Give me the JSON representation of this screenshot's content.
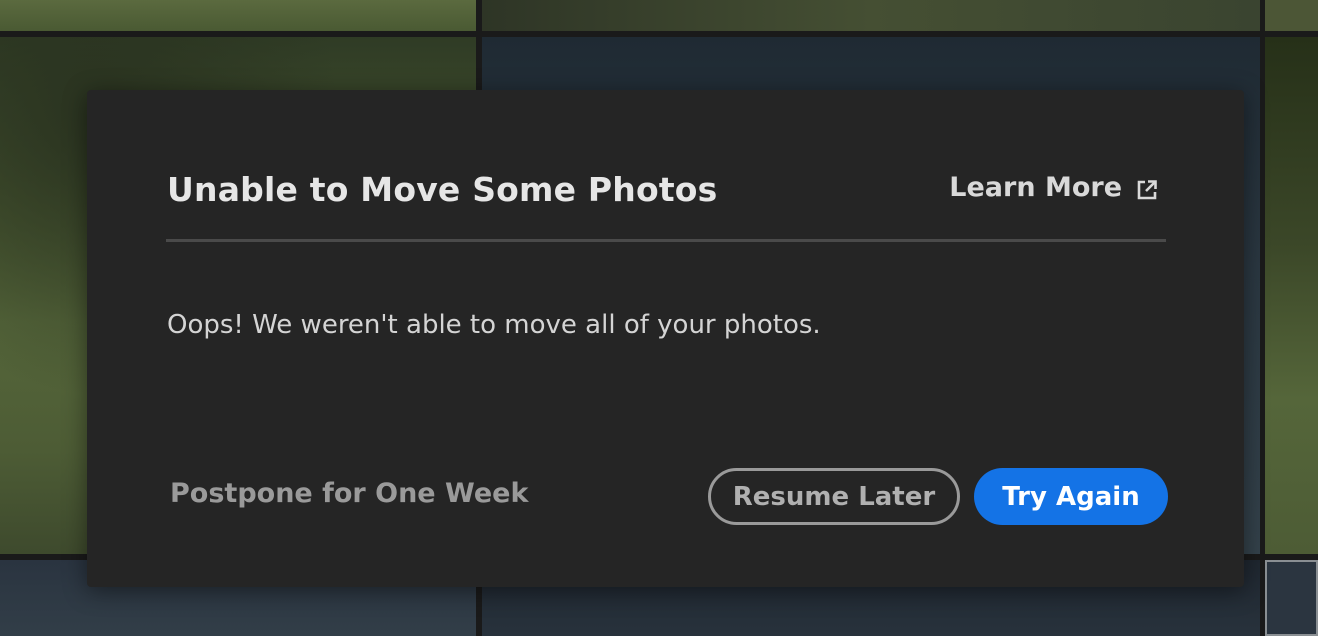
{
  "dialog": {
    "title": "Unable to Move Some Photos",
    "learn_more_label": "Learn More",
    "learn_more_icon": "external-link-icon",
    "message": "Oops! We weren't able to move all of your photos.",
    "postpone_label": "Postpone for One Week",
    "resume_later_label": "Resume Later",
    "try_again_label": "Try Again"
  },
  "colors": {
    "dialog_background": "#252525",
    "primary_button": "#1473e6",
    "title_text": "#e6e6e6",
    "muted_text": "#9a9a9a"
  }
}
